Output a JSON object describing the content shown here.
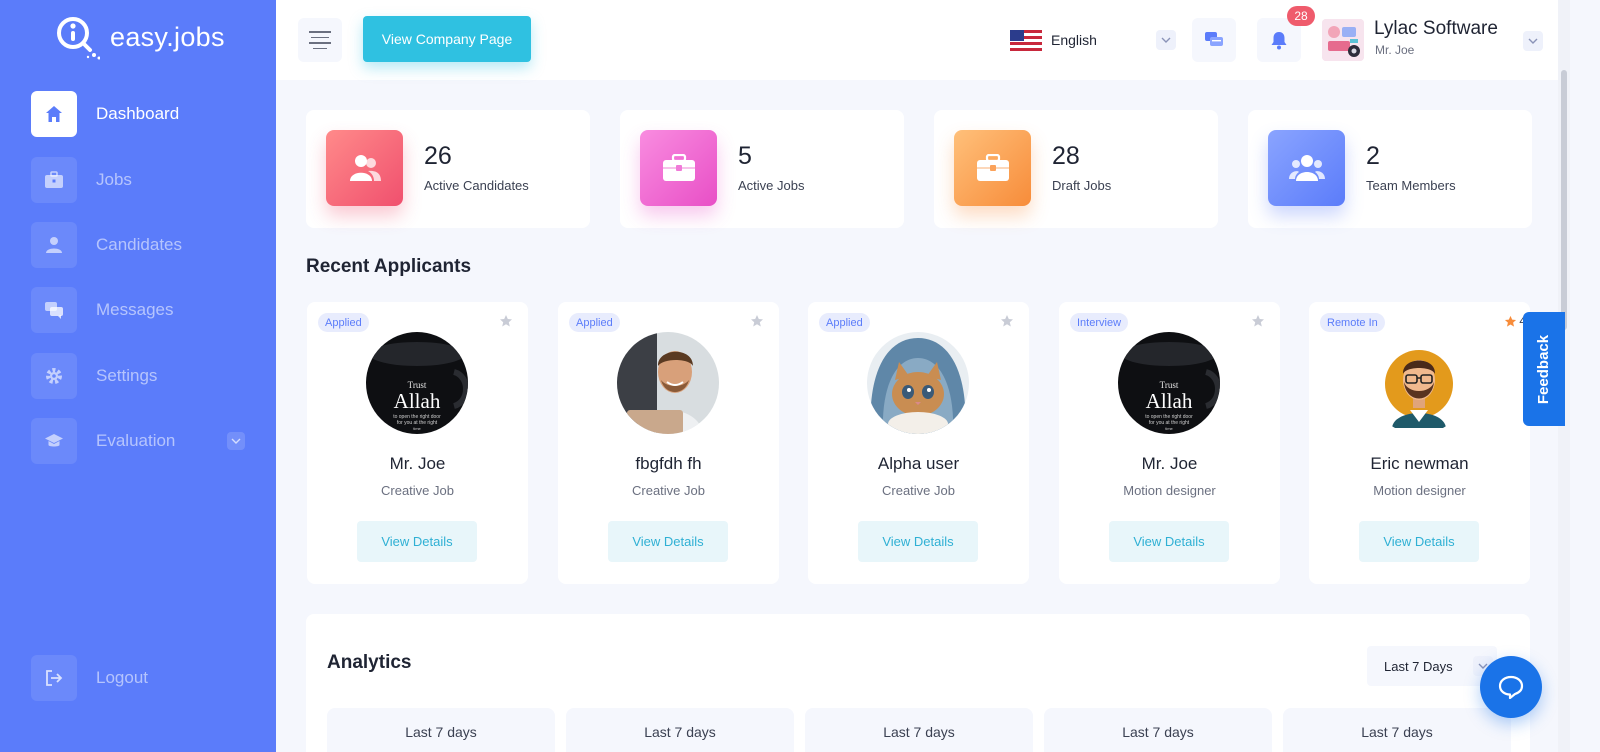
{
  "brand": {
    "name": "easy.jobs"
  },
  "sidebar": {
    "items": [
      {
        "label": "Dashboard",
        "icon": "home-icon",
        "active": true
      },
      {
        "label": "Jobs",
        "icon": "briefcase-icon",
        "active": false
      },
      {
        "label": "Candidates",
        "icon": "user-icon",
        "active": false
      },
      {
        "label": "Messages",
        "icon": "chat-icon",
        "active": false
      },
      {
        "label": "Settings",
        "icon": "gear-icon",
        "active": false
      },
      {
        "label": "Evaluation",
        "icon": "graduation-cap-icon",
        "active": false
      }
    ],
    "logout_label": "Logout"
  },
  "header": {
    "company_page_label": "View Company Page",
    "language": "English",
    "notification_count": "28",
    "company_name": "Lylac Software",
    "user_name": "Mr. Joe"
  },
  "stats": [
    {
      "value": "26",
      "label": "Active Candidates",
      "color_from": "#ff8a8a",
      "color_to": "#f0506e",
      "icon": "users-icon"
    },
    {
      "value": "5",
      "label": "Active Jobs",
      "color_from": "#f98ce0",
      "color_to": "#e84fc6",
      "icon": "briefcase-icon"
    },
    {
      "value": "28",
      "label": "Draft Jobs",
      "color_from": "#ffc07a",
      "color_to": "#f78c3a",
      "icon": "briefcase-icon"
    },
    {
      "value": "2",
      "label": "Team Members",
      "color_from": "#8aa4ff",
      "color_to": "#5b7cfa",
      "icon": "team-icon"
    }
  ],
  "recent_applicants": {
    "title": "Recent Applicants",
    "view_label": "View Details",
    "items": [
      {
        "status": "Applied",
        "name": "Mr. Joe",
        "role": "Creative Job",
        "photo": "trust-allah-mug",
        "rating": ""
      },
      {
        "status": "Applied",
        "name": "fbgfdh fh",
        "role": "Creative Job",
        "photo": "smiling-man-laptop",
        "rating": ""
      },
      {
        "status": "Applied",
        "name": "Alpha user",
        "role": "Creative Job",
        "photo": "kitten-in-hood",
        "rating": ""
      },
      {
        "status": "Interview",
        "name": "Mr. Joe",
        "role": "Motion designer",
        "photo": "trust-allah-mug",
        "rating": ""
      },
      {
        "status": "Remote In",
        "name": "Eric newman",
        "role": "Motion designer",
        "photo": "bearded-man-avatar",
        "rating": "4"
      }
    ],
    "photo_text": {
      "line1": "Trust",
      "line2": "Allah",
      "line3": "to open the right door",
      "line4": "for you at the right",
      "line5": "time"
    }
  },
  "analytics": {
    "title": "Analytics",
    "range": "Last 7 Days",
    "cards": [
      "Last 7 days",
      "Last 7 days",
      "Last 7 days",
      "Last 7 days",
      "Last 7 days"
    ]
  },
  "feedback_label": "Feedback"
}
